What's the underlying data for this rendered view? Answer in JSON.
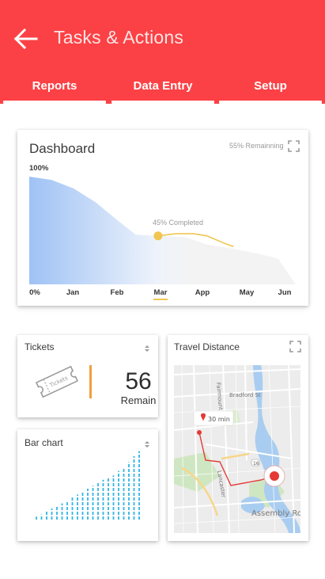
{
  "header": {
    "title": "Tasks & Actions",
    "back_icon": "arrow-left-icon",
    "background": "#fb4145"
  },
  "tabs": [
    {
      "label": "Reports"
    },
    {
      "label": "Data Entry"
    },
    {
      "label": "Setup"
    }
  ],
  "dashboard": {
    "title": "Dashboard",
    "remaining": "55% Remainning",
    "top_label": "100%",
    "completed_label": "45% Completed",
    "axis": [
      "0%",
      "Jan",
      "Feb",
      "Mar",
      "App",
      "May",
      "Jun"
    ],
    "selected_axis": "Mar",
    "accent": "#f1c550"
  },
  "tickets": {
    "title": "Tickets",
    "icon_label": "Tickets",
    "count": "56",
    "count_label": "Remain",
    "accent": "#f0a03c"
  },
  "travel": {
    "title": "Travel Distance",
    "time_label": "30 min",
    "map_labels": [
      "Fairmount",
      "Bradford St",
      "Lancaster",
      "Assembly Ro"
    ],
    "route_color": "#e53935"
  },
  "barchart": {
    "title": "Bar chart",
    "bar_color": "#30b4e6"
  },
  "chart_data": [
    {
      "type": "area",
      "title": "Dashboard",
      "categories": [
        "Jan",
        "Feb",
        "Mar",
        "App",
        "May",
        "Jun"
      ],
      "ylim": [
        0,
        100
      ],
      "annotations": [
        "100%",
        "0%",
        "45% Completed",
        "55% Remainning"
      ],
      "x": [
        0,
        0.5,
        1,
        1.5,
        2,
        2.4,
        2.9,
        3.5,
        4.0,
        4.6,
        5.1,
        5.6,
        6.0
      ],
      "values": [
        100,
        97,
        89,
        76,
        59,
        46,
        45,
        44,
        37,
        33,
        29,
        24,
        0
      ],
      "completed_line_x": [
        2.9,
        3.3,
        3.7,
        4.0,
        4.4,
        4.6
      ],
      "completed_line_y": [
        45,
        47,
        47,
        45,
        38,
        35
      ],
      "marker": {
        "x": 2.9,
        "y": 45
      }
    },
    {
      "type": "bar",
      "title": "Bar chart",
      "values": [
        4,
        7,
        11,
        15,
        19,
        22,
        26,
        30,
        34,
        38,
        42,
        46,
        50,
        54,
        57,
        60,
        66,
        70,
        78,
        86,
        93
      ]
    }
  ]
}
